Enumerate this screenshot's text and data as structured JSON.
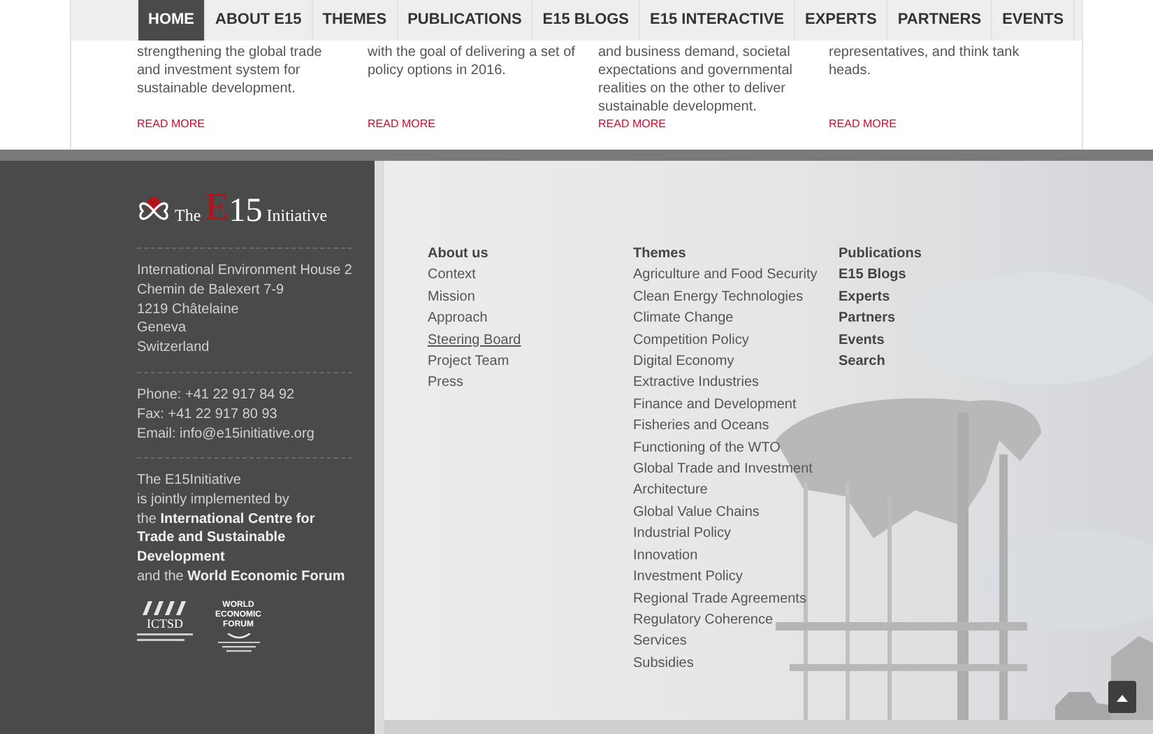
{
  "nav": {
    "items": [
      {
        "label": "HOME",
        "selected": true
      },
      {
        "label": "ABOUT E15",
        "selected": false
      },
      {
        "label": "THEMES",
        "selected": false
      },
      {
        "label": "PUBLICATIONS",
        "selected": false
      },
      {
        "label": "E15 BLOGS",
        "selected": false
      },
      {
        "label": "E15 INTERACTIVE",
        "selected": false
      },
      {
        "label": "EXPERTS",
        "selected": false
      },
      {
        "label": "PARTNERS",
        "selected": false
      },
      {
        "label": "EVENTS",
        "selected": false
      }
    ]
  },
  "articles": [
    {
      "excerpt": "strengthening the global trade\nand investment system for\nsustainable development.",
      "link": "READ MORE"
    },
    {
      "excerpt": "with the goal of delivering a set of\npolicy options in 2016.",
      "link": "READ MORE"
    },
    {
      "excerpt": "and business demand, societal\nexpectations and governmental\nrealities on the other to deliver\nsustainable development.",
      "link": "READ MORE"
    },
    {
      "excerpt": "representatives, and think tank\nheads.",
      "link": "READ MORE"
    }
  ],
  "footer": {
    "logo": {
      "prefix": "The",
      "letter": "E",
      "number": "15",
      "suffix": "Initiative"
    },
    "address": [
      "International Environment House 2",
      "Chemin de Balexert 7-9",
      "1219 Châtelaine",
      "Geneva",
      "Switzerland"
    ],
    "contact": [
      "Phone: +41 22 917 84 92",
      "Fax: +41 22 917 80 93",
      "Email: info@e15initiative.org"
    ],
    "partnership": "The E15Initiative\nis jointly implemented by\nthe **International Centre for Trade and Sustainable Development**\nand the **World Economic Forum**",
    "partner_logos": [
      {
        "kind": "ictsd",
        "name": "ICTSD"
      },
      {
        "kind": "wef",
        "name": "WORLD\nECONOMIC\nFORUM"
      }
    ],
    "about": {
      "title": "About us",
      "items": [
        {
          "label": "Context",
          "underlined": false
        },
        {
          "label": "Mission",
          "underlined": false
        },
        {
          "label": "Approach",
          "underlined": false
        },
        {
          "label": "Steering Board",
          "underlined": true
        },
        {
          "label": "Project Team",
          "underlined": false
        },
        {
          "label": "Press",
          "underlined": false
        }
      ]
    },
    "themes": {
      "title": "Themes",
      "items": [
        "Agriculture and Food Security",
        "Clean Energy Technologies",
        "Climate Change",
        "Competition Policy",
        "Digital Economy",
        "Extractive Industries",
        "Finance and Development",
        "Fisheries and Oceans",
        "Functioning of the WTO",
        "Global Trade and Investment",
        "Architecture",
        "Global Value Chains",
        "Industrial Policy",
        "Innovation",
        "Investment Policy",
        "Regional Trade Agreements",
        "Regulatory Coherence",
        "Services",
        "Subsidies"
      ]
    },
    "more": {
      "title": "Publications",
      "items": [
        "E15 Blogs",
        "Experts",
        "Partners",
        "Events",
        "Search"
      ]
    }
  }
}
